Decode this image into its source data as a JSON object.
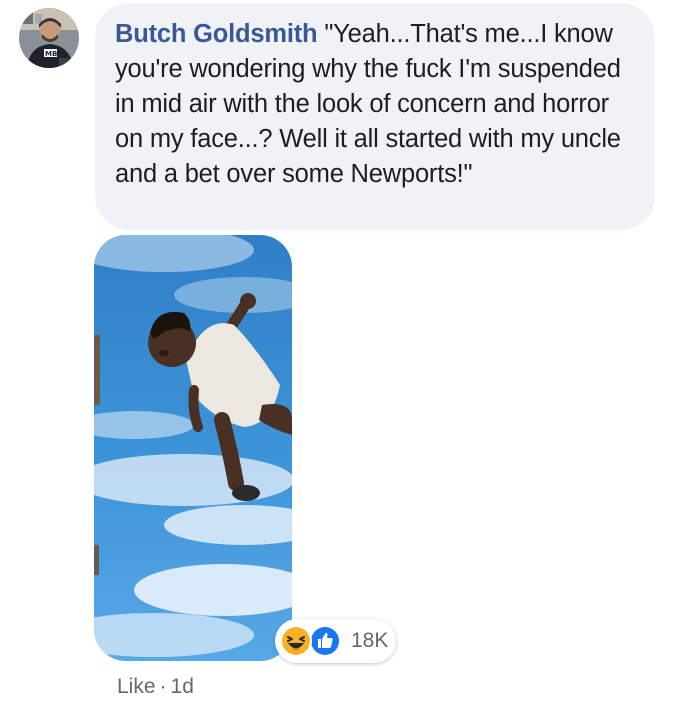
{
  "comment": {
    "author": "Butch Goldsmith",
    "text": "\"Yeah...That's me...I know you're wondering why the fuck I'm suspended in mid air with the look of concern and horror on my face...? Well it all started with my uncle and a bet over some Newports!\""
  },
  "reactions": {
    "icons": [
      "haha-icon",
      "like-icon"
    ],
    "count": "18K"
  },
  "actions": {
    "like_label": "Like",
    "separator": "·",
    "timestamp": "1d"
  },
  "colors": {
    "bubble_bg": "#f0f2f5",
    "author_link": "#385898",
    "meta_text": "#65676b",
    "like_blue": "#1877f2",
    "haha_yellow": "#f7b125"
  }
}
